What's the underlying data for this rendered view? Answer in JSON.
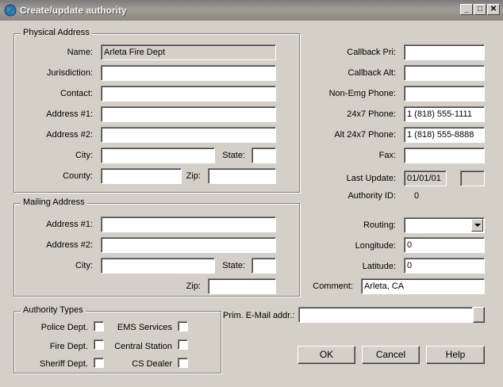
{
  "window": {
    "title": "Create/update authority",
    "min_glyph": "_",
    "max_glyph": "□",
    "close_glyph": "✕"
  },
  "physical": {
    "legend": "Physical Address",
    "name_label": "Name:",
    "name_value": "Arleta Fire Dept",
    "jurisdiction_label": "Jurisdiction:",
    "jurisdiction_value": "",
    "contact_label": "Contact:",
    "contact_value": "",
    "addr1_label": "Address #1:",
    "addr1_value": "",
    "addr2_label": "Address #2:",
    "addr2_value": "",
    "city_label": "City:",
    "city_value": "",
    "state_label": "State:",
    "state_value": "",
    "county_label": "County:",
    "county_value": "",
    "zip_label": "Zip:",
    "zip_value": ""
  },
  "mailing": {
    "legend": "Mailing Address",
    "addr1_label": "Address #1:",
    "addr1_value": "",
    "addr2_label": "Address #2:",
    "addr2_value": "",
    "city_label": "City:",
    "city_value": "",
    "state_label": "State:",
    "state_value": "",
    "zip_label": "Zip:",
    "zip_value": ""
  },
  "types": {
    "legend": "Authority Types",
    "police": "Police Dept.",
    "ems": "EMS Services",
    "fire": "Fire Dept.",
    "central": "Central Station",
    "sheriff": "Sheriff Dept.",
    "cs_dealer": "CS Dealer"
  },
  "right": {
    "callback_pri_label": "Callback Pri:",
    "callback_pri_value": "",
    "callback_alt_label": "Callback Alt:",
    "callback_alt_value": "",
    "nonemg_label": "Non-Emg Phone:",
    "nonemg_value": "",
    "phone247_label": "24x7 Phone:",
    "phone247_value": "1 (818) 555-1111",
    "alt247_label": "Alt 24x7 Phone:",
    "alt247_value": "1 (818) 555-8888",
    "fax_label": "Fax:",
    "fax_value": "",
    "last_update_label": "Last Update:",
    "last_update_value": "01/01/01",
    "authority_id_label": "Authority ID:",
    "authority_id_value": "0",
    "routing_label": "Routing:",
    "routing_value": "",
    "longitude_label": "Longitude:",
    "longitude_value": "0",
    "latitude_label": "Latitude:",
    "latitude_value": "0",
    "comment_label": "Comment:",
    "comment_value": "Arleta, CA"
  },
  "email": {
    "label": "Prim. E-Mail addr.:",
    "value": ""
  },
  "buttons": {
    "ok": "OK",
    "cancel": "Cancel",
    "help": "Help"
  }
}
